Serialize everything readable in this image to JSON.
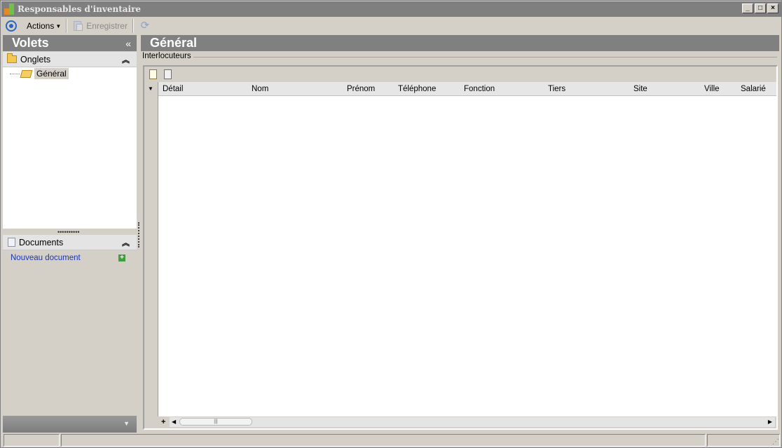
{
  "window": {
    "title": "Responsables d'inventaire",
    "buttons": [
      "_",
      "□",
      "×"
    ]
  },
  "toolbar": {
    "actions_label": "Actions",
    "save_label": "Enregistrer"
  },
  "left_pane": {
    "title": "Volets",
    "collapse_glyph": "«",
    "onglets": {
      "label": "Onglets",
      "items": [
        {
          "label": "Général"
        }
      ]
    },
    "documents": {
      "label": "Documents",
      "new_link": "Nouveau document"
    }
  },
  "right_pane": {
    "title": "Général",
    "group_label": "Interlocuteurs",
    "grid": {
      "columns": [
        "Détail",
        "Nom",
        "Prénom",
        "Téléphone",
        "Fonction",
        "Tiers",
        "Site",
        "Ville",
        "Salarié"
      ],
      "rows": []
    }
  },
  "colors": {
    "header_bg": "#808080",
    "window_bg": "#d4d0c8",
    "link": "#1a35b8"
  },
  "icons": [
    "app-icon",
    "navigate-circle-icon",
    "save-icon",
    "refresh-icon",
    "folder-icon",
    "open-folder-icon",
    "document-icon",
    "add-icon",
    "new-record-icon",
    "edit-record-icon"
  ]
}
